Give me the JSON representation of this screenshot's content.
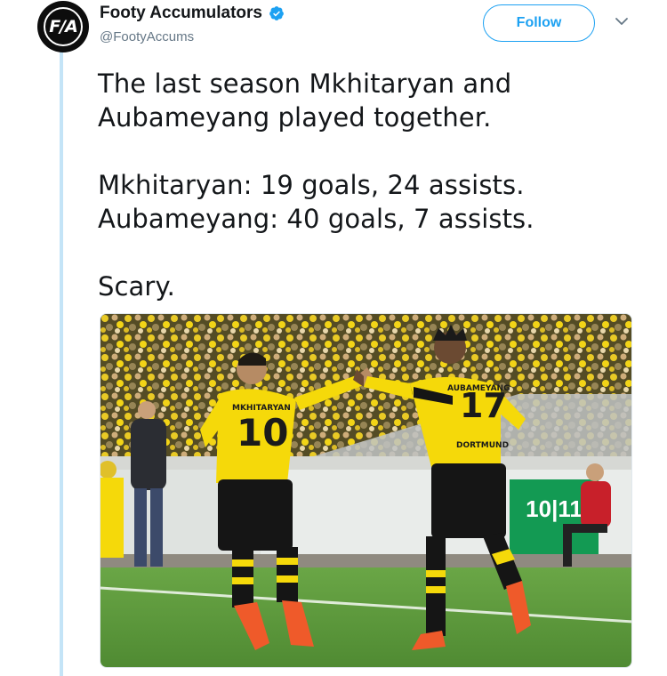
{
  "account": {
    "display_name": "Footy Accumulators",
    "handle": "@FootyAccums",
    "avatar_text": "F/A",
    "verified": true
  },
  "actions": {
    "follow_label": "Follow"
  },
  "tweet": {
    "lines": [
      "The last season Mkhitaryan and",
      "Aubameyang played together.",
      "",
      "Mkhitaryan: 19 goals, 24 assists.",
      "Aubameyang: 40 goals, 7 assists.",
      "",
      "Scary."
    ]
  },
  "media": {
    "jersey_names": [
      "MKHITARYAN",
      "AUBAMEYANG"
    ],
    "jersey_numbers": [
      "10",
      "17"
    ],
    "sponsor": "DORTMUND",
    "board_text": "10|11"
  },
  "colors": {
    "accent": "#1da1f2",
    "thread_line": "#c4e4f7",
    "bvb_yellow": "#f5d90a",
    "pitch_green": "#5e9a3c"
  },
  "icons": [
    "verified-badge-icon",
    "chevron-down-icon"
  ]
}
